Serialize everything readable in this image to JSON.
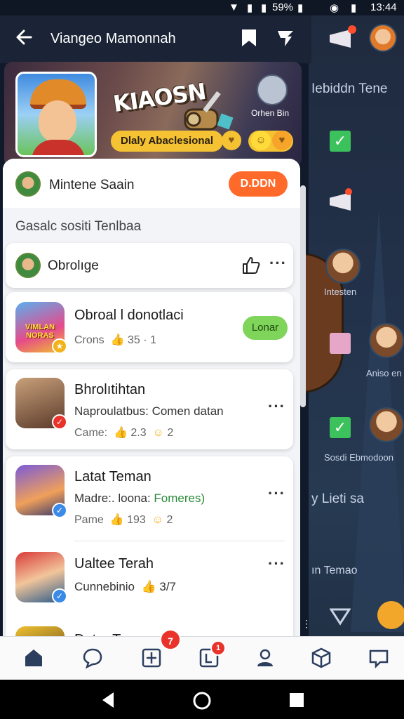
{
  "status_bar": {
    "battery": "59%",
    "time": "13:44"
  },
  "header": {
    "title": "Viangeo Mamonnah"
  },
  "banner": {
    "logo_text": "KIAOSN",
    "mascot_label": "Orhen Bin",
    "pill_label": "Dlaly Abaclesional"
  },
  "owner": {
    "name": "Mintene Saain",
    "button_label": "D.DDN"
  },
  "section_label": "Gasalc sositi Tenlbaa",
  "group_head": {
    "name": "Obrolıge"
  },
  "items": [
    {
      "title": "Obroal l donotlaci",
      "meta_label": "Crons",
      "meta_value": "35 · 1",
      "button_label": "Lonar",
      "avatar_text": "VIMLAN\nNORAS"
    },
    {
      "title": "Bhrolıtihtan",
      "subtitle": "Naproulatbus: Comen datan",
      "meta_label": "Came:",
      "meta_value_a": "2.3",
      "meta_value_b": "2"
    },
    {
      "title": "Latat Teman",
      "subtitle_a": "Madre:. loona: ",
      "subtitle_b": "Fomeres)",
      "meta_label": "Pame",
      "meta_value_a": "193",
      "meta_value_b": "2"
    },
    {
      "title": "Ualtee Terah",
      "meta_label": "Cunnebinio",
      "meta_value": "3/7"
    },
    {
      "title": "Datar Teman"
    }
  ],
  "background_panel": {
    "text_1": "Iebiddn Tene",
    "text_2": "Intesten",
    "text_3": "Aniso en",
    "text_4": "Sosdi Ebmodoon",
    "text_5": "y Lieti sa",
    "text_6": "ın Temao"
  },
  "nav": {
    "badge_1": "7",
    "badge_2": "1"
  },
  "colors": {
    "accent_orange": "#ff6a2a",
    "accent_green": "#7fd45a",
    "badge_red": "#e8322a",
    "header_bg": "#1a2436"
  }
}
